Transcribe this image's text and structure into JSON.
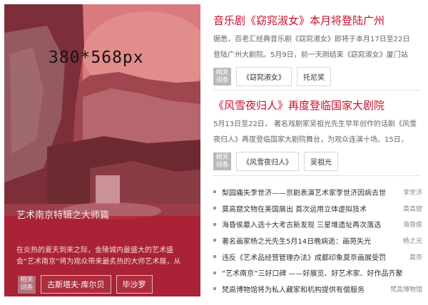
{
  "feature": {
    "placeholder_text": "380*568px",
    "title": "艺术南京特辑之大师篇",
    "desc_line1": "在炎热的夏天到来之际，金陵城内最盛大的艺术盛",
    "desc_line2": "会“艺术南京”将为观众带来最炙热的大师艺术展，从",
    "tag_badge_line1": "相关",
    "tag_badge_line2": "词条",
    "tags": [
      "古斯塔夫·库尔贝",
      "毕沙罗"
    ]
  },
  "articles": [
    {
      "title": "音乐剧《窈窕淑女》本月将登陆广州",
      "desc_line1": "据悉，百老汇经典音乐剧《窈窕淑女》即将于本月17日至22日",
      "desc_line2": "登陆广州大剧院。5月9日，前一天刚结束《窈窕淑女》厦门站",
      "badge_line1": "相关",
      "badge_line2": "词条",
      "tags": [
        "《窈窕淑女》",
        "托尼奖"
      ]
    },
    {
      "title": "《风雪夜归人》再度登临国家大剧院",
      "desc_line1": "5月13日至22日， 著名戏剧家吴祖光先生早年创作的话剧《风雪",
      "desc_line2": "夜归人》再度登临国家大剧院舞台，为观众连演十场。15日，",
      "badge_line1": "相关",
      "badge_line2": "词条",
      "tags": [
        "《风雪夜归人》",
        "吴祖光"
      ]
    }
  ],
  "news": [
    {
      "title": "梨园痛失李世济——京剧表演艺术家李世济因病去世",
      "author": "李世济"
    },
    {
      "title": "莫高窟文物在美国展出 首次运用立体虚拟技术",
      "author": "莫高窟"
    },
    {
      "title": "海昏侯墓入选十大考古新发现 三星堆遗址再次落选",
      "author": "海昏侯"
    },
    {
      "title": "著名画家杨之光先生5月14日晚病逝：画苑失光",
      "author": "杨之光"
    },
    {
      "title": "违反《艺术品经营管理办法》成都印象莫奈画展受罚",
      "author": "莫奈"
    },
    {
      "title": "“艺术南京”三好口碑 ——好展览、好艺术家、好作品齐聚",
      "author": ""
    },
    {
      "title": "梵高博物馆将为私人藏家和机构提供有偿服务",
      "author": "梵高博物馆"
    }
  ]
}
